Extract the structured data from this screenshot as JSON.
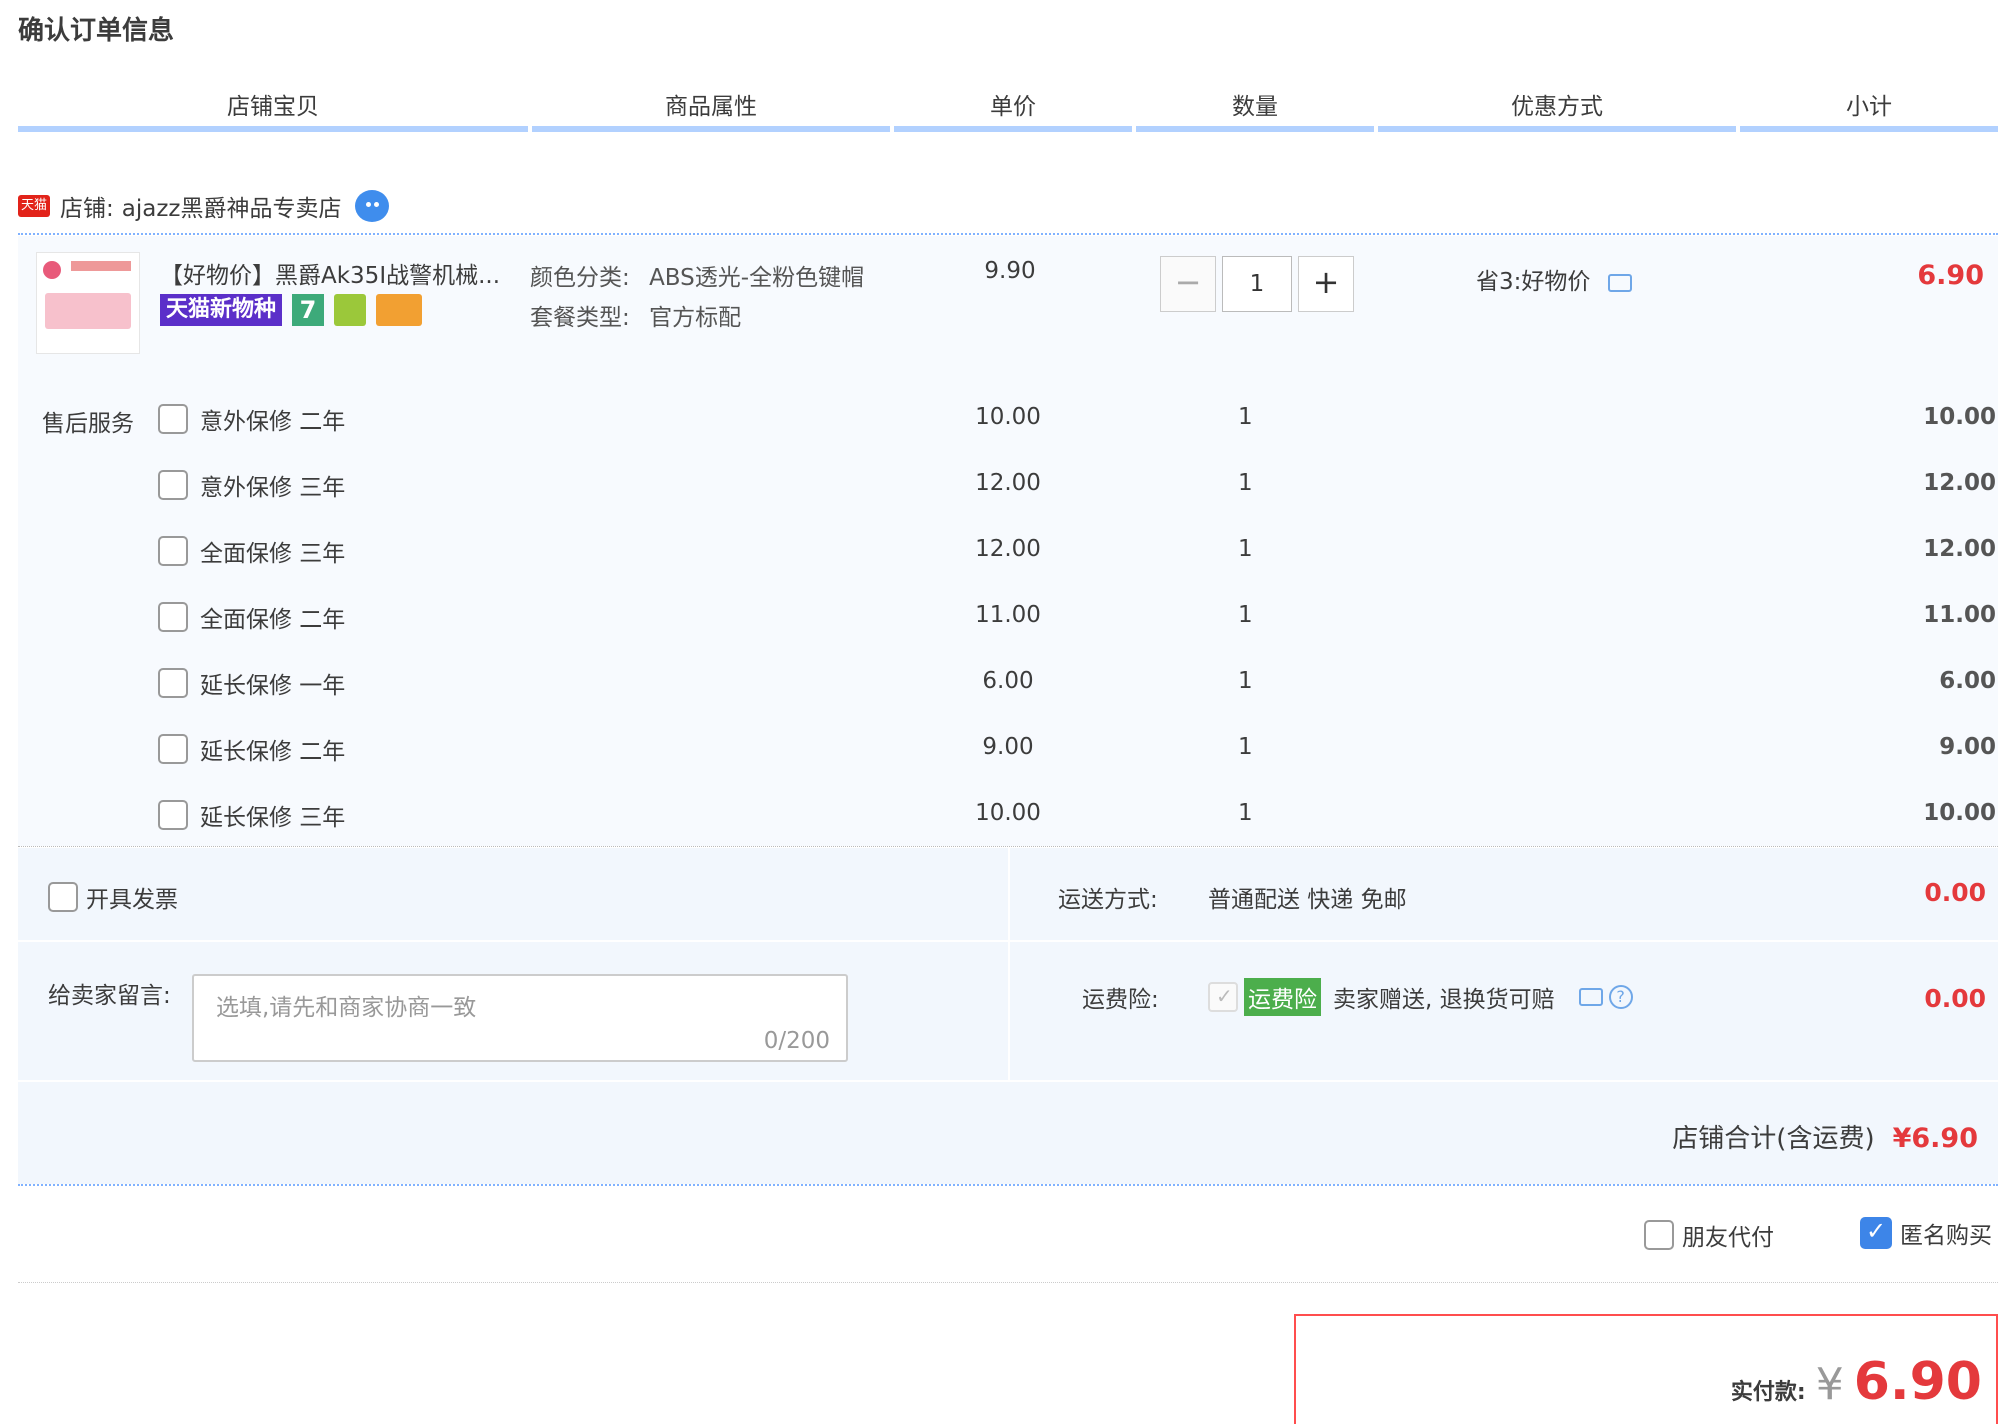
{
  "page_title": "确认订单信息",
  "table_headers": [
    "店铺宝贝",
    "商品属性",
    "单价",
    "数量",
    "优惠方式",
    "小计"
  ],
  "shop": {
    "prefix": "店铺:",
    "name": "ajazz黑爵神品专卖店",
    "tmall_logo": "天猫"
  },
  "item": {
    "title": "【好物价】黑爵Ak35I战警机械...",
    "badge_new": "天猫新物种",
    "badge_seven": "7",
    "attr1_label": "颜色分类:",
    "attr1_value": "ABS透光-全粉色键帽",
    "attr2_label": "套餐类型:",
    "attr2_value": "官方标配",
    "price": "9.90",
    "qty": "1",
    "minus": "−",
    "plus": "+",
    "promo": "省3:好物价",
    "subtotal": "6.90"
  },
  "service": {
    "label": "售后服务",
    "rows": [
      {
        "name": "意外保修 二年",
        "price": "10.00",
        "qty": "1",
        "subtotal": "10.00"
      },
      {
        "name": "意外保修 三年",
        "price": "12.00",
        "qty": "1",
        "subtotal": "12.00"
      },
      {
        "name": "全面保修 三年",
        "price": "12.00",
        "qty": "1",
        "subtotal": "12.00"
      },
      {
        "name": "全面保修 二年",
        "price": "11.00",
        "qty": "1",
        "subtotal": "11.00"
      },
      {
        "name": "延长保修 一年",
        "price": "6.00",
        "qty": "1",
        "subtotal": "6.00"
      },
      {
        "name": "延长保修 二年",
        "price": "9.00",
        "qty": "1",
        "subtotal": "9.00"
      },
      {
        "name": "延长保修 三年",
        "price": "10.00",
        "qty": "1",
        "subtotal": "10.00"
      }
    ]
  },
  "invoice": {
    "label": "开具发票"
  },
  "memo": {
    "label": "给卖家留言:",
    "placeholder": "选填,请先和商家协商一致",
    "count": "0/200"
  },
  "shipping": {
    "label": "运送方式:",
    "value": "普通配送 快递 免邮",
    "fee": "0.00"
  },
  "insurance": {
    "label": "运费险:",
    "tag": "运费险",
    "value": "卖家赠送, 退换货可赔",
    "fee": "0.00",
    "help": "?"
  },
  "shop_total": {
    "label": "店铺合计(含运费)",
    "value": "¥6.90"
  },
  "options": {
    "friend_pay": "朋友代付",
    "anonymous": "匿名购买"
  },
  "pay": {
    "label": "实付款:",
    "currency": "¥",
    "amount": "6.90"
  },
  "colors": {
    "accent_red": "#e4393c",
    "header_blue": "#b2d1ff",
    "row_bg": "#f7fafe",
    "check_blue": "#3d85e8"
  }
}
